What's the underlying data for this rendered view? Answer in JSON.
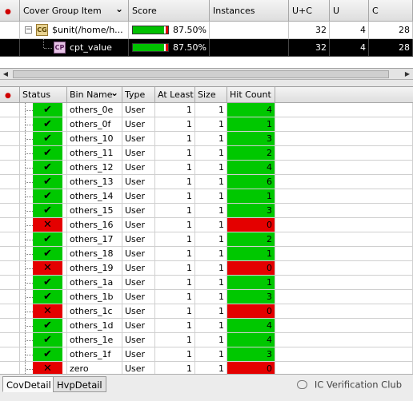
{
  "top_grid": {
    "headers": [
      "Cover Group Item",
      "Score",
      "Instances",
      "U+C",
      "U",
      "C"
    ],
    "rows": [
      {
        "badge": "CG",
        "name": "$unit(/home/h...",
        "score_pct": 87.5,
        "score": "87.50%",
        "instances": "",
        "uc": "32",
        "u": "4",
        "c": "28",
        "selected": false
      },
      {
        "badge": "CP",
        "name": "cpt_value",
        "score_pct": 87.5,
        "score": "87.50%",
        "instances": "",
        "uc": "32",
        "u": "4",
        "c": "28",
        "selected": true
      }
    ]
  },
  "bin_grid": {
    "headers": [
      "Status",
      "Bin Name",
      "Type",
      "At Least",
      "Size",
      "Hit Count"
    ],
    "rows": [
      {
        "status": "ok",
        "name": "others_0e",
        "type": "User",
        "at_least": "1",
        "size": "1",
        "hit": "4"
      },
      {
        "status": "ok",
        "name": "others_0f",
        "type": "User",
        "at_least": "1",
        "size": "1",
        "hit": "1"
      },
      {
        "status": "ok",
        "name": "others_10",
        "type": "User",
        "at_least": "1",
        "size": "1",
        "hit": "3"
      },
      {
        "status": "ok",
        "name": "others_11",
        "type": "User",
        "at_least": "1",
        "size": "1",
        "hit": "2"
      },
      {
        "status": "ok",
        "name": "others_12",
        "type": "User",
        "at_least": "1",
        "size": "1",
        "hit": "4"
      },
      {
        "status": "ok",
        "name": "others_13",
        "type": "User",
        "at_least": "1",
        "size": "1",
        "hit": "6"
      },
      {
        "status": "ok",
        "name": "others_14",
        "type": "User",
        "at_least": "1",
        "size": "1",
        "hit": "1"
      },
      {
        "status": "ok",
        "name": "others_15",
        "type": "User",
        "at_least": "1",
        "size": "1",
        "hit": "3"
      },
      {
        "status": "bad",
        "name": "others_16",
        "type": "User",
        "at_least": "1",
        "size": "1",
        "hit": "0"
      },
      {
        "status": "ok",
        "name": "others_17",
        "type": "User",
        "at_least": "1",
        "size": "1",
        "hit": "2"
      },
      {
        "status": "ok",
        "name": "others_18",
        "type": "User",
        "at_least": "1",
        "size": "1",
        "hit": "1"
      },
      {
        "status": "bad",
        "name": "others_19",
        "type": "User",
        "at_least": "1",
        "size": "1",
        "hit": "0"
      },
      {
        "status": "ok",
        "name": "others_1a",
        "type": "User",
        "at_least": "1",
        "size": "1",
        "hit": "1"
      },
      {
        "status": "ok",
        "name": "others_1b",
        "type": "User",
        "at_least": "1",
        "size": "1",
        "hit": "3"
      },
      {
        "status": "bad",
        "name": "others_1c",
        "type": "User",
        "at_least": "1",
        "size": "1",
        "hit": "0"
      },
      {
        "status": "ok",
        "name": "others_1d",
        "type": "User",
        "at_least": "1",
        "size": "1",
        "hit": "4"
      },
      {
        "status": "ok",
        "name": "others_1e",
        "type": "User",
        "at_least": "1",
        "size": "1",
        "hit": "4"
      },
      {
        "status": "ok",
        "name": "others_1f",
        "type": "User",
        "at_least": "1",
        "size": "1",
        "hit": "3"
      },
      {
        "status": "bad",
        "name": "zero",
        "type": "User",
        "at_least": "1",
        "size": "1",
        "hit": "0"
      }
    ]
  },
  "tabs": [
    "CovDetail",
    "HvpDetail"
  ],
  "watermark": "IC Verification Club",
  "colors": {
    "covered": "#00c800",
    "uncovered": "#e40000",
    "selected_row": "#000000"
  },
  "icons": {
    "check": "✔",
    "cross": "✕",
    "row_marker": "●",
    "sort": "⌄"
  }
}
